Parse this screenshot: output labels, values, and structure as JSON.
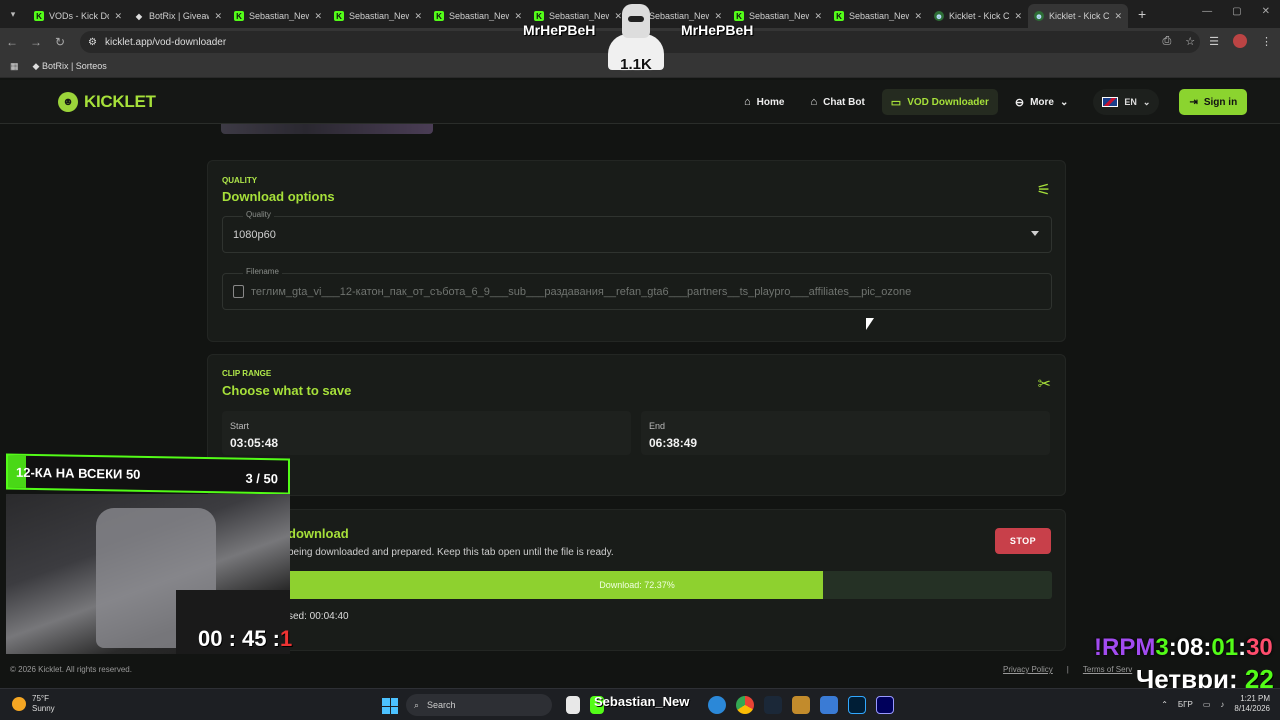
{
  "browser": {
    "tabs": [
      {
        "label": "VODs - Kick Do",
        "favicon": "k",
        "active": false
      },
      {
        "label": "BotRix | Giveaw",
        "favicon": "b",
        "active": false
      },
      {
        "label": "Sebastian_New",
        "favicon": "k",
        "active": false
      },
      {
        "label": "Sebastian_New",
        "favicon": "k",
        "active": false
      },
      {
        "label": "Sebastian_New",
        "favicon": "k",
        "active": false
      },
      {
        "label": "Sebastian_New",
        "favicon": "k",
        "active": false
      },
      {
        "label": "Sebastian_New",
        "favicon": "k",
        "active": false
      },
      {
        "label": "Sebastian_New",
        "favicon": "k",
        "active": false
      },
      {
        "label": "Sebastian_New",
        "favicon": "k",
        "active": false
      },
      {
        "label": "Kicklet - Kick C",
        "favicon": "kl",
        "active": false
      },
      {
        "label": "Kicklet - Kick C",
        "favicon": "kl",
        "active": true
      }
    ],
    "url": "kicklet.app/vod-downloader",
    "bookmark": "BotRix | Sorteos"
  },
  "site": {
    "logo_text": "KICKLET",
    "nav": {
      "home": "Home",
      "chat_bot": "Chat Bot",
      "vod_downloader": "VOD Downloader",
      "more": "More",
      "lang": "EN",
      "sign_in": "Sign in"
    }
  },
  "quality_card": {
    "eyebrow": "QUALITY",
    "title": "Download options",
    "quality_label": "Quality",
    "quality_value": "1080p60",
    "filename_label": "Filename",
    "filename_value": "теглим_gta_vi___12-катон_пак_от_събота_6_9___sub___раздавания__refan_gta6___partners__ts_playpro___affiliates__pic_ozone"
  },
  "clip_card": {
    "eyebrow": "CLIP RANGE",
    "title": "Choose what to save",
    "start_label": "Start",
    "start_value": "03:05:48",
    "end_label": "End",
    "end_value": "06:38:49"
  },
  "download_card": {
    "title": "download",
    "status": "being downloaded and prepared. Keep this tab open until the file is ready.",
    "stop_label": "STOP",
    "progress_text": "Download: 72.37%",
    "progress_percent": 72.37,
    "elapsed": "sed: 00:04:40"
  },
  "footer": {
    "copyright": "© 2026 Kicklet. All rights reserved.",
    "privacy": "Privacy Policy",
    "separator": "|",
    "terms": "Terms of Serv"
  },
  "overlay": {
    "name_left": "MrHePBeH",
    "name_right": "MrHePBeH",
    "viewer_count": "1.1K",
    "banner_title": "12-КА НА ВСЕКИ 50",
    "banner_count": "3 / 50",
    "timer_main": "00 : 45 :",
    "timer_red": "1",
    "rpm_prefix": "!RPM",
    "rpm_h": "3",
    "rpm_sep1": ":08:",
    "rpm_m": "01",
    "rpm_sep2": ":",
    "rpm_s": "30",
    "day_text": "Четври: ",
    "day_num": "22"
  },
  "taskbar": {
    "temperature": "75°F",
    "condition": "Sunny",
    "search_label": "Search",
    "app_label": "Sebastian_New",
    "lang": "БГР",
    "time": "1:21 PM",
    "date": "8/14/2026"
  }
}
